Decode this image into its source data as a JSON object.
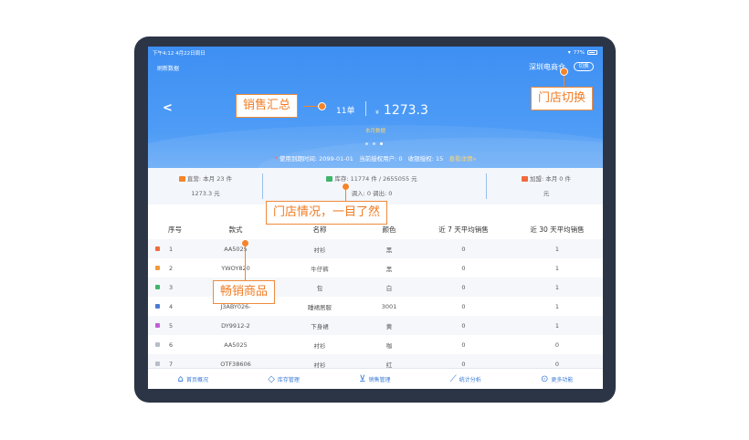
{
  "status_bar": {
    "time": "下午4:12  4月22日周日",
    "battery": "77%"
  },
  "header": {
    "refresh_label": "刷新数据",
    "store_name": "深圳电商仓",
    "switch_label": "切换",
    "orders": "11单",
    "currency": "¥",
    "amount": "1273.3",
    "period": "本月数据",
    "license": {
      "expiry_label": "使用到期时间: 2099-01-01",
      "authorized_users": "当前授权用户: 0",
      "cashier_auth": "收银授权: 15",
      "detail_link": "查看详情»"
    }
  },
  "stats": {
    "direct": {
      "line1": "直营: 本月 23 件",
      "line2": "1273.3 元"
    },
    "stock": {
      "line1": "库存: 11774 件 / 2655055 元",
      "line2": "调入: 0 调出: 0"
    },
    "franchise": {
      "line1": "加盟: 本月 0 件",
      "line2": "元"
    }
  },
  "table": {
    "headers": [
      "序号",
      "款式",
      "名称",
      "颜色",
      "近 7 天平均销售",
      "近 30 天平均销售"
    ],
    "rows": [
      {
        "no": "1",
        "code": "AA5025",
        "name": "衬衫",
        "color": "黑",
        "d7": "0",
        "d30": "1"
      },
      {
        "no": "2",
        "code": "YWOY820",
        "name": "牛仔裤",
        "color": "黑",
        "d7": "0",
        "d30": "1"
      },
      {
        "no": "3",
        "code": "",
        "name": "包",
        "color": "白",
        "d7": "0",
        "d30": "1"
      },
      {
        "no": "4",
        "code": "J3ABY026-",
        "name": "睡裙居服",
        "color": "3001",
        "d7": "0",
        "d30": "1"
      },
      {
        "no": "5",
        "code": "DY9912-2",
        "name": "下身裙",
        "color": "黄",
        "d7": "0",
        "d30": "1"
      },
      {
        "no": "6",
        "code": "AA5025",
        "name": "衬衫",
        "color": "咖",
        "d7": "0",
        "d30": "0"
      },
      {
        "no": "7",
        "code": "OTF38606",
        "name": "衬衫",
        "color": "红",
        "d7": "0",
        "d30": "0"
      }
    ],
    "rank_colors": [
      "#f06b3c",
      "#f39a3c",
      "#3fb56b",
      "#4a7bd5",
      "#c05fd6",
      "#b8bec8",
      "#b8bec8"
    ]
  },
  "tabbar": [
    {
      "label": "首页概况",
      "icon": "home-icon"
    },
    {
      "label": "库存管理",
      "icon": "box-icon"
    },
    {
      "label": "销售管理",
      "icon": "cart-icon"
    },
    {
      "label": "统计分析",
      "icon": "chart-icon"
    },
    {
      "label": "更多功能",
      "icon": "more-icon"
    }
  ],
  "callouts": {
    "sales_summary": "销售汇总",
    "store_switch": "门店切换",
    "store_overview": "门店情况，一目了然",
    "best_sellers": "畅销商品"
  },
  "colors": {
    "primary": "#3e8ff3",
    "accent": "#f5842a",
    "frame": "#2c3546"
  }
}
